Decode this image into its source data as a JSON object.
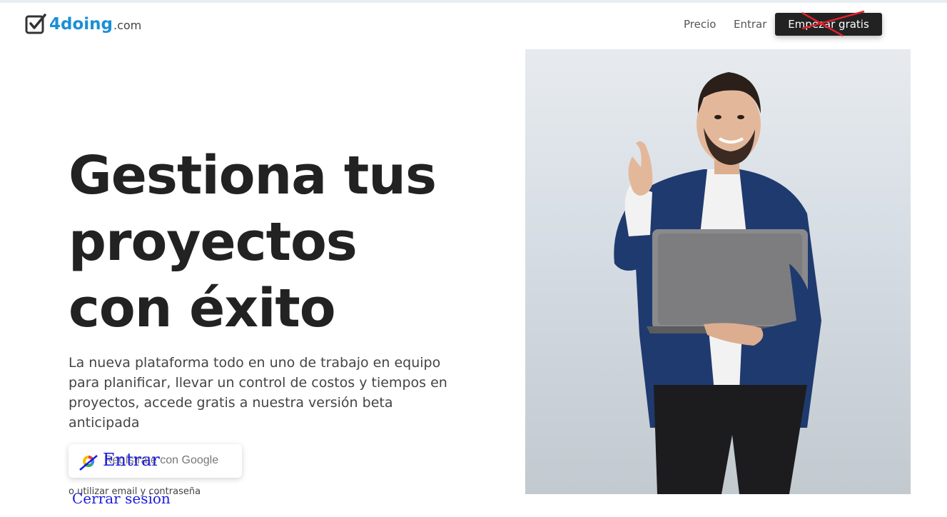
{
  "brand": {
    "name": "4doing",
    "tld": ".com"
  },
  "nav": {
    "items": [
      {
        "label": "Precio"
      },
      {
        "label": "Entrar"
      }
    ],
    "cta_label": "Empezar gratis"
  },
  "hero": {
    "headline_lines": [
      "Gestiona tus",
      "proyectos",
      "con éxito"
    ],
    "lead": "La nueva plataforma todo en uno de trabajo en equipo para planificar, llevar un control de costos y tiempos en proyectos, accede gratis a nuestra versión beta anticipada",
    "google_button_label": "Regístrate con Google",
    "google_overlay_text": "Entrar",
    "alt_text": "o utilizar email y contraseña",
    "logout_link": "Cerrar sesión"
  },
  "photo": {
    "icon": "businessman-thumbs-up-laptop"
  },
  "colors": {
    "brand_blue": "#1b8fd6",
    "dark": "#222222",
    "overlay_blue": "#1a1adf",
    "cross_red": "#e0202a"
  }
}
